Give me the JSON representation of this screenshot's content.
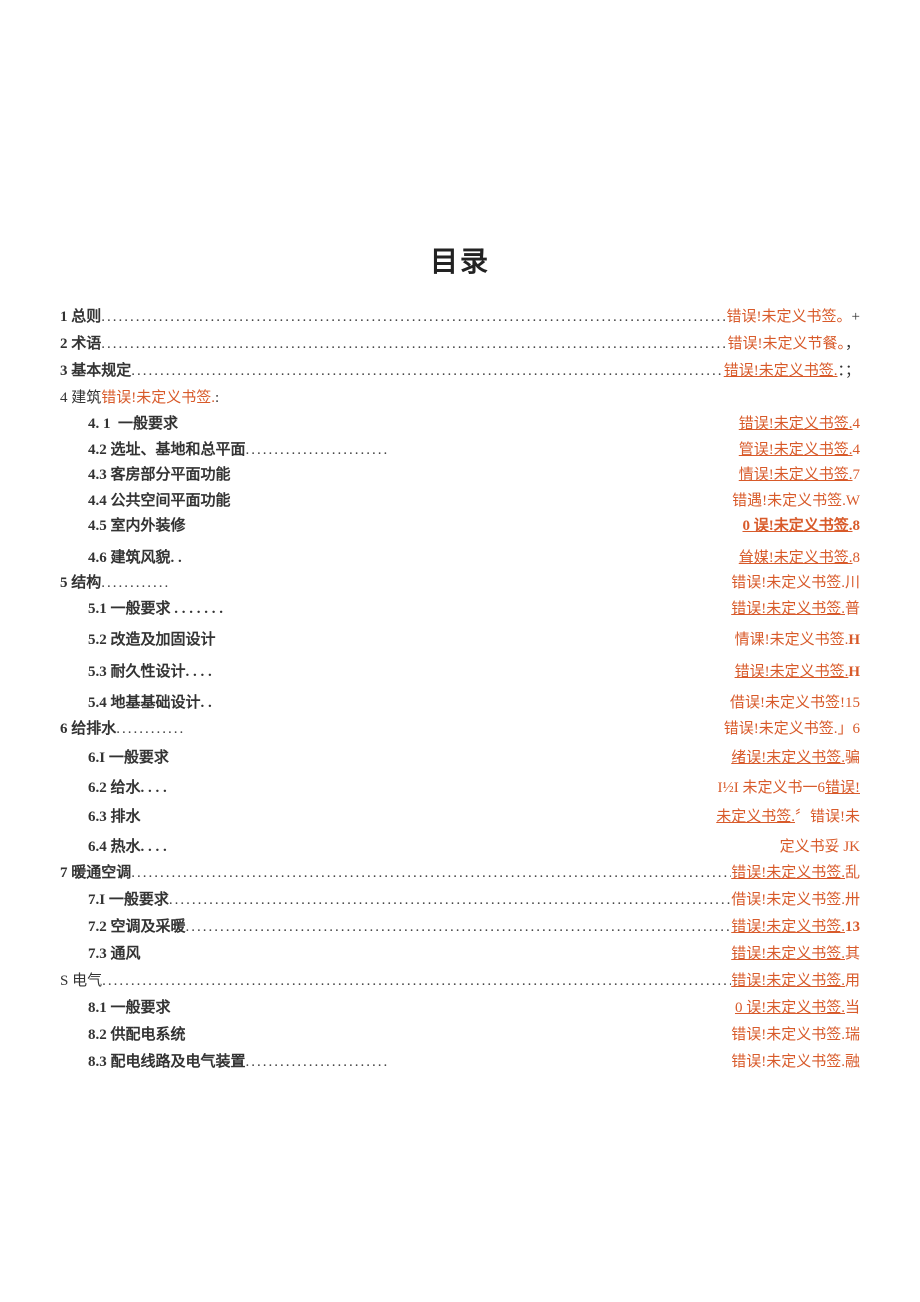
{
  "title": "目录",
  "s1": {
    "label": "1 总则",
    "ref": "错误!未定义书签。",
    "tail": "+"
  },
  "s2": {
    "label": "2 术语",
    "ref": "错误!未定义节餐。",
    "tail": "，"
  },
  "s3": {
    "label": "3 基本规定",
    "ref": "错误!未定义书签.",
    "tail": "：；"
  },
  "s4": {
    "label_pre": "4 建筑",
    "label_err": "错误!未定义书签.",
    "label_post": ":",
    "sub": [
      {
        "n": "4. 1",
        "t": "一般要求",
        "ref": "错误!未定义书签.",
        "tail": "4",
        "u": true
      },
      {
        "n": "4.2",
        "t": "选址、基地和总平面",
        "ref": "管误!未定义书签.",
        "tail": "4",
        "u": true,
        "dots": true
      },
      {
        "n": "4.3",
        "t": "客房部分平面功能",
        "ref": "情误!未定义书签.",
        "tail": "7",
        "u": true
      },
      {
        "n": "4.4",
        "t": "公共空间平面功能",
        "ref": "错遇!未定义书签.",
        "tail": "W",
        "u": false
      },
      {
        "n": "4.5",
        "t": "室内外装修",
        "ref": "0 误!未定义书签.",
        "tail": "8",
        "u": true
      },
      {
        "n": "4.6",
        "t": "建筑风貌. .",
        "ref": "耸媒!未定义书签.",
        "tail": "8",
        "u": true
      }
    ]
  },
  "s5": {
    "label": "5 结构",
    "ref0": "错误!未定义书签.",
    "tail0": "川",
    "sub": [
      {
        "n": "5.1",
        "t": "一般要求 . . . . . . .",
        "ref": "错误!未定义书签.",
        "tail": "普",
        "u": true
      },
      {
        "n": "5.2",
        "t": "改造及加固设计",
        "ref": "情课!未定义书签.",
        "tail": "H",
        "u": false
      },
      {
        "n": "5.3",
        "t": "耐久性设计. . . .",
        "ref": "错误!未定义书签.",
        "tail": "H",
        "u": true
      },
      {
        "n": "5.4",
        "t": "地基基础设计. .",
        "ref": "借误!未定义书签",
        "tail": "!15",
        "u": false
      }
    ]
  },
  "s6": {
    "label": "6 给排水",
    "ref0": "错误!未定义书签.",
    "tail0": "」6",
    "sub": [
      {
        "n": "6.I",
        "t": "一般要求",
        "ref": "绪误!末定义书签.",
        "tail": " 骗",
        "u": true
      },
      {
        "n": "6.2",
        "t": "给水. . . .",
        "ref": "I½I 未定义书一6",
        "tail": " 错误!",
        "u": false,
        "uTail": true
      },
      {
        "n": "6.3",
        "t": "排水",
        "ref": "未定义书签.",
        "tail": "〞错误!未",
        "u": true
      },
      {
        "n": "6.4",
        "t": "热水. . . .",
        "ref": "定义书妥 JK",
        "tail": "",
        "u": false
      }
    ]
  },
  "s7": {
    "label": "7 暖通空调",
    "ref0": "错误!未定义书签.",
    "tail0": "乱",
    "u0": true,
    "sub": [
      {
        "n": "7.I",
        "t": "一般要求",
        "ref": "借误!未定义书签.",
        "tail": "卅",
        "u": false,
        "dots": true
      },
      {
        "n": "7.2",
        "t": "空调及采暖",
        "ref": "错误!未定义书签.",
        "tail": "13",
        "u": true,
        "dots": true
      },
      {
        "n": "7.3",
        "t": "通风",
        "ref": "错误!未定义书签.",
        "tail": "其",
        "u": true
      }
    ]
  },
  "s8": {
    "label": "S 电气",
    "ref0": "错误!未定义书签.",
    "tail0": "用",
    "u0": true,
    "sub": [
      {
        "n": "8.1",
        "t": "一般要求",
        "ref": "0 误!末定义书签.",
        "tail": "当",
        "u": true
      },
      {
        "n": "8.2",
        "t": "供配电系统",
        "ref": "错误!未定义书签.",
        "tail": "瑞",
        "u": false
      },
      {
        "n": "8.3",
        "t": "配电线路及电气装置",
        "ref": "错误!未定义书签.",
        "tail": "融",
        "u": false,
        "dots": true
      }
    ]
  }
}
